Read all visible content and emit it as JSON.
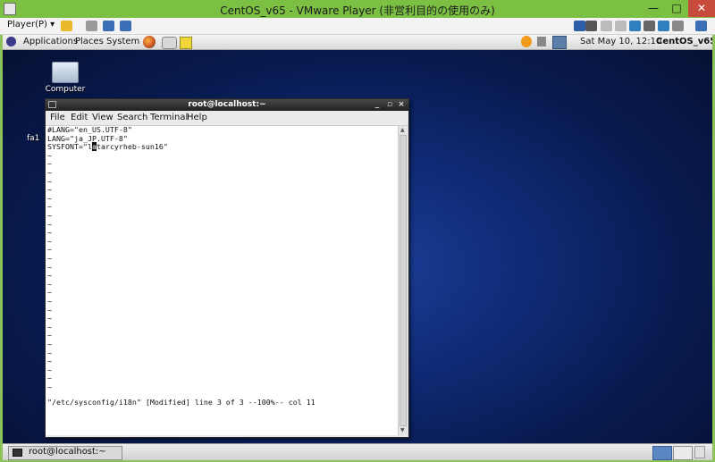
{
  "vmware": {
    "title": "CentOS_v65 - VMware Player (非営利目的の使用のみ)",
    "player_menu": "Player(P)",
    "minimize": "—",
    "maximize": "□",
    "close": "✕"
  },
  "gnome_panel": {
    "menus": [
      "Applications",
      "Places",
      "System"
    ],
    "clock": "Sat May 10, 12:10",
    "hostname": "CentOS_v65"
  },
  "desktop": {
    "computer_label": "Computer",
    "partial_label": "fa1"
  },
  "terminal": {
    "title": "root@localhost:~",
    "menus": [
      "File",
      "Edit",
      "View",
      "Search",
      "Terminal",
      "Help"
    ],
    "lines": [
      "#LANG=\"en_US.UTF-8\"",
      "LANG=\"ja_JP.UTF-8\""
    ],
    "sysfont_prefix": "SYSFONT=\"l",
    "sysfont_cursor": "a",
    "sysfont_suffix": "tarcyrheb-sun16\"",
    "tilde": "~",
    "status": "\"/etc/sysconfig/i18n\" [Modified] line 3 of 3 --100%-- col 11"
  },
  "taskbar": {
    "task_label": "root@localhost:~"
  },
  "colors": {
    "vmware_titlebar": "#7cc043",
    "desktop_blue": "#0f2a74",
    "close_red": "#c84c3c"
  }
}
